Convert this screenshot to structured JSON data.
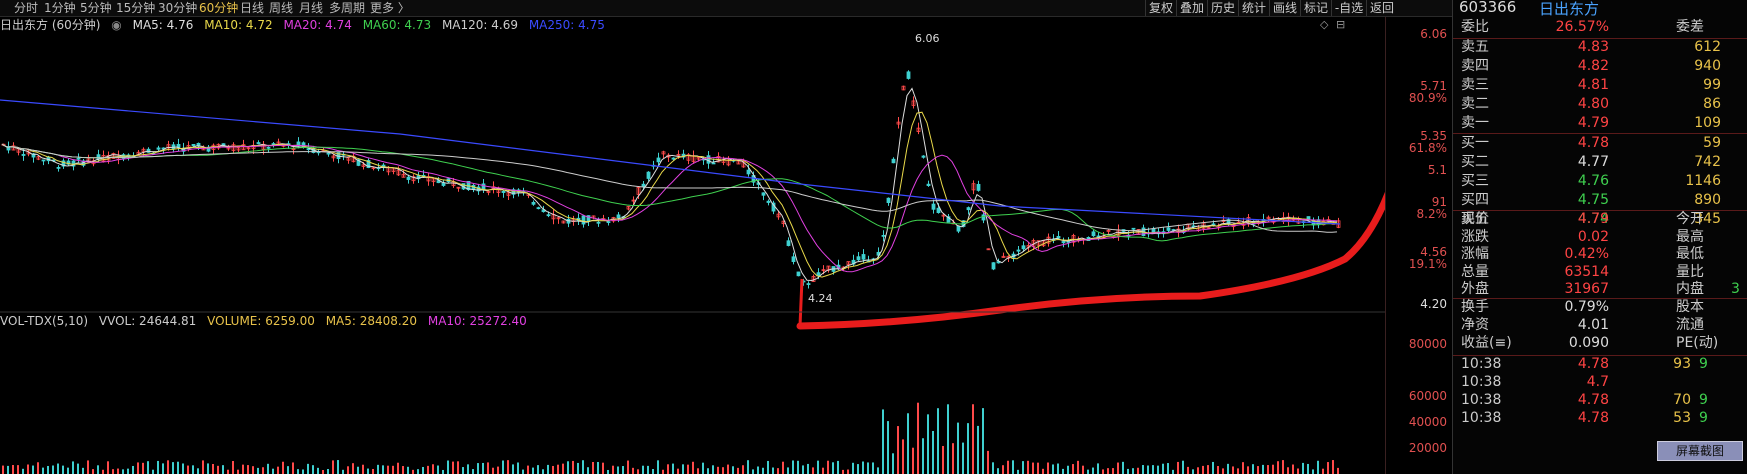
{
  "toolbar": {
    "periods": [
      "分时",
      "1分钟",
      "5分钟",
      "15分钟",
      "30分钟",
      "60分钟",
      "日线",
      "周线",
      "月线",
      "多周期",
      "更多 〉"
    ],
    "active_period": "60分钟",
    "buttons": [
      "复权",
      "叠加",
      "历史",
      "统计",
      "画线",
      "标记",
      "-自选",
      "返回"
    ]
  },
  "chart_title": "日出东方 (60分钟)",
  "ma_legend": [
    {
      "label": "MA5: 4.76",
      "color": "#dddddd"
    },
    {
      "label": "MA10: 4.72",
      "color": "#e8d84a"
    },
    {
      "label": "MA20: 4.74",
      "color": "#e040e0"
    },
    {
      "label": "MA60: 4.73",
      "color": "#3fd04f"
    },
    {
      "label": "MA120: 4.69",
      "color": "#cccccc"
    },
    {
      "label": "MA250: 4.75",
      "color": "#3a4aff"
    }
  ],
  "price_axis": {
    "labels": [
      {
        "text": "6.06",
        "class": "red"
      },
      {
        "text": "5.71",
        "class": "red"
      },
      {
        "text": "80.9%",
        "class": "red"
      },
      {
        "text": "5.35",
        "class": "red"
      },
      {
        "text": "61.8%",
        "class": "red"
      },
      {
        "text": "5.1",
        "class": "red"
      },
      {
        "text": "91",
        "class": "red"
      },
      {
        "text": "8.2%",
        "class": "red"
      },
      {
        "text": "4.56",
        "class": "red"
      },
      {
        "text": "19.1%",
        "class": "red"
      },
      {
        "text": "4.20",
        "class": "white"
      }
    ],
    "vol_labels": [
      "80000",
      "60000",
      "40000",
      "20000"
    ]
  },
  "chart_annotations": {
    "high": "6.06",
    "low": "4.24"
  },
  "vol_header": {
    "name": "VOL-TDX(5,10)",
    "vvol": "VVOL: 24644.81",
    "volume": "VOLUME: 6259.00",
    "ma5": "MA5: 28408.20",
    "ma10": "MA10: 25272.40"
  },
  "quote": {
    "code": "603366",
    "name": "日出东方",
    "weibi_label": "委比",
    "weibi_value": "26.57%",
    "weicha_label": "委差",
    "asks": [
      {
        "label": "卖五",
        "price": "4.83",
        "vol": "612"
      },
      {
        "label": "卖四",
        "price": "4.82",
        "vol": "940"
      },
      {
        "label": "卖三",
        "price": "4.81",
        "vol": "99"
      },
      {
        "label": "卖二",
        "price": "4.80",
        "vol": "86"
      },
      {
        "label": "卖一",
        "price": "4.79",
        "vol": "109"
      }
    ],
    "bids": [
      {
        "label": "买一",
        "price": "4.78",
        "vol": "59",
        "pc": "red"
      },
      {
        "label": "买二",
        "price": "4.77",
        "vol": "742",
        "pc": "white"
      },
      {
        "label": "买三",
        "price": "4.76",
        "vol": "1146",
        "pc": "green"
      },
      {
        "label": "买四",
        "price": "4.75",
        "vol": "890",
        "pc": "green"
      },
      {
        "label": "买五",
        "price": "4.74",
        "vol": "345",
        "pc": "green"
      }
    ],
    "stats": [
      {
        "l": "现价",
        "v": "4.79",
        "vc": "red",
        "r": "今开"
      },
      {
        "l": "涨跌",
        "v": "0.02",
        "vc": "red",
        "r": "最高"
      },
      {
        "l": "涨幅",
        "v": "0.42%",
        "vc": "red",
        "r": "最低"
      },
      {
        "l": "总量",
        "v": "63514",
        "vc": "red",
        "r": "量比"
      },
      {
        "l": "外盘",
        "v": "31967",
        "vc": "red",
        "r": "内盘"
      }
    ],
    "stats2": [
      {
        "l": "换手",
        "v": "0.79%",
        "vc": "white",
        "r": "股本"
      },
      {
        "l": "净资",
        "v": "4.01",
        "vc": "white",
        "r": "流通"
      },
      {
        "l": "收益(≡)",
        "v": "0.090",
        "vc": "white",
        "r": "PE(动)"
      }
    ],
    "inner_partial": "3",
    "ticks": [
      {
        "t": "10:38",
        "p": "4.78",
        "v": "93",
        "f": "9"
      },
      {
        "t": "10:38",
        "p": "4.7",
        "v": "",
        "f": ""
      },
      {
        "t": "10:38",
        "p": "4.78",
        "v": "70",
        "f": "9"
      },
      {
        "t": "10:38",
        "p": "4.78",
        "v": "53",
        "f": "9"
      }
    ],
    "screenshot_btn": "屏幕截图"
  }
}
